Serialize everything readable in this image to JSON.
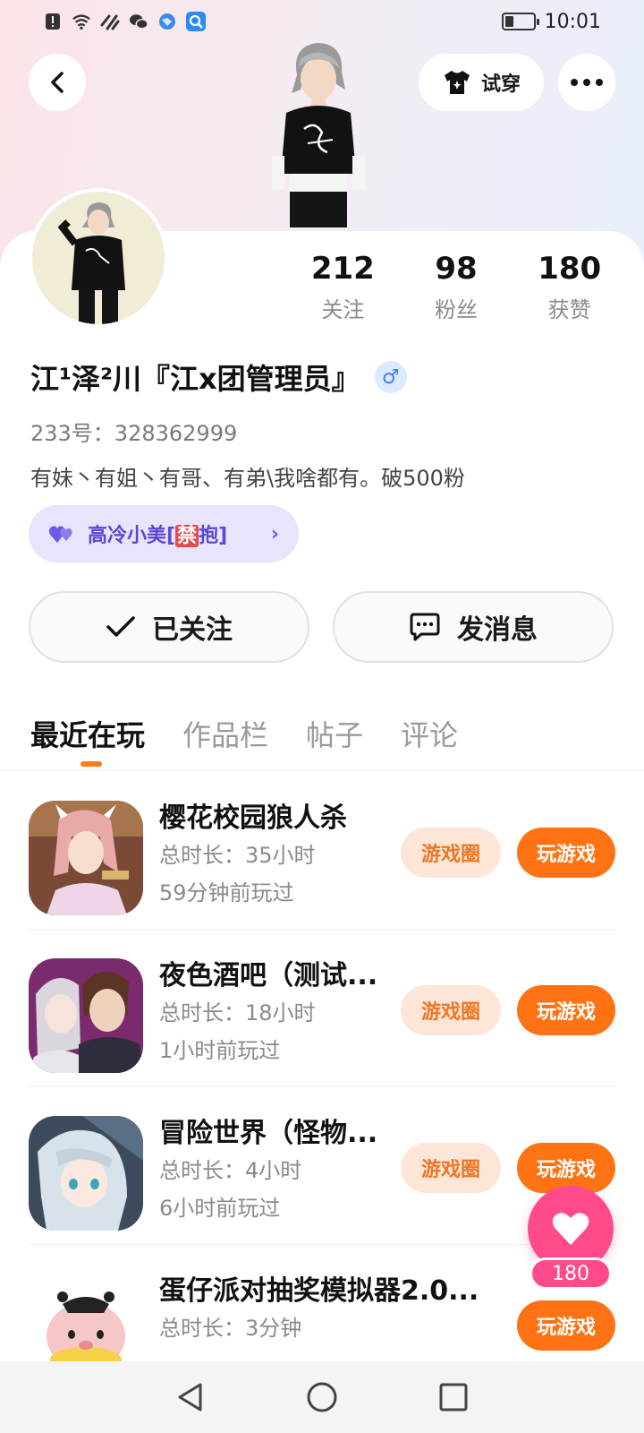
{
  "status_bar": {
    "time": "10:01"
  },
  "header": {
    "tryon_label": "试穿"
  },
  "stats": [
    {
      "num": "212",
      "label": "关注"
    },
    {
      "num": "98",
      "label": "粉丝"
    },
    {
      "num": "180",
      "label": "获赞"
    }
  ],
  "profile": {
    "name": "江¹泽²川『江x团管理员』",
    "gender_symbol": "♂",
    "uid": "233号：328362999",
    "bio": "有妹丶有姐丶有哥、有弟\\我啥都有。破500粉",
    "tag_pre": "高冷小美[",
    "tag_forbid": "禁",
    "tag_post": "抱]"
  },
  "actions": {
    "follow_label": "已关注",
    "message_label": "发消息"
  },
  "tabs": [
    "最近在玩",
    "作品栏",
    "帖子",
    "评论"
  ],
  "games": [
    {
      "title": "樱花校园狼人杀",
      "duration": "总时长：35小时",
      "last_played": "59分钟前玩过",
      "circle_label": "游戏圈",
      "play_label": "玩游戏"
    },
    {
      "title": "夜色酒吧（测试...",
      "duration": "总时长：18小时",
      "last_played": "1小时前玩过",
      "circle_label": "游戏圈",
      "play_label": "玩游戏"
    },
    {
      "title": "冒险世界（怪物...",
      "duration": "总时长：4小时",
      "last_played": "6小时前玩过",
      "circle_label": "游戏圈",
      "play_label": "玩游戏"
    },
    {
      "title": "蛋仔派对抽奖模拟器2.0...",
      "duration": "总时长：3分钟",
      "play_label": "玩游戏"
    }
  ],
  "likes": {
    "count": "180"
  },
  "colors": {
    "accent_orange": "#ff7315",
    "like_pink": "#ff4b8c",
    "tag_purple": "#5a48d6"
  }
}
